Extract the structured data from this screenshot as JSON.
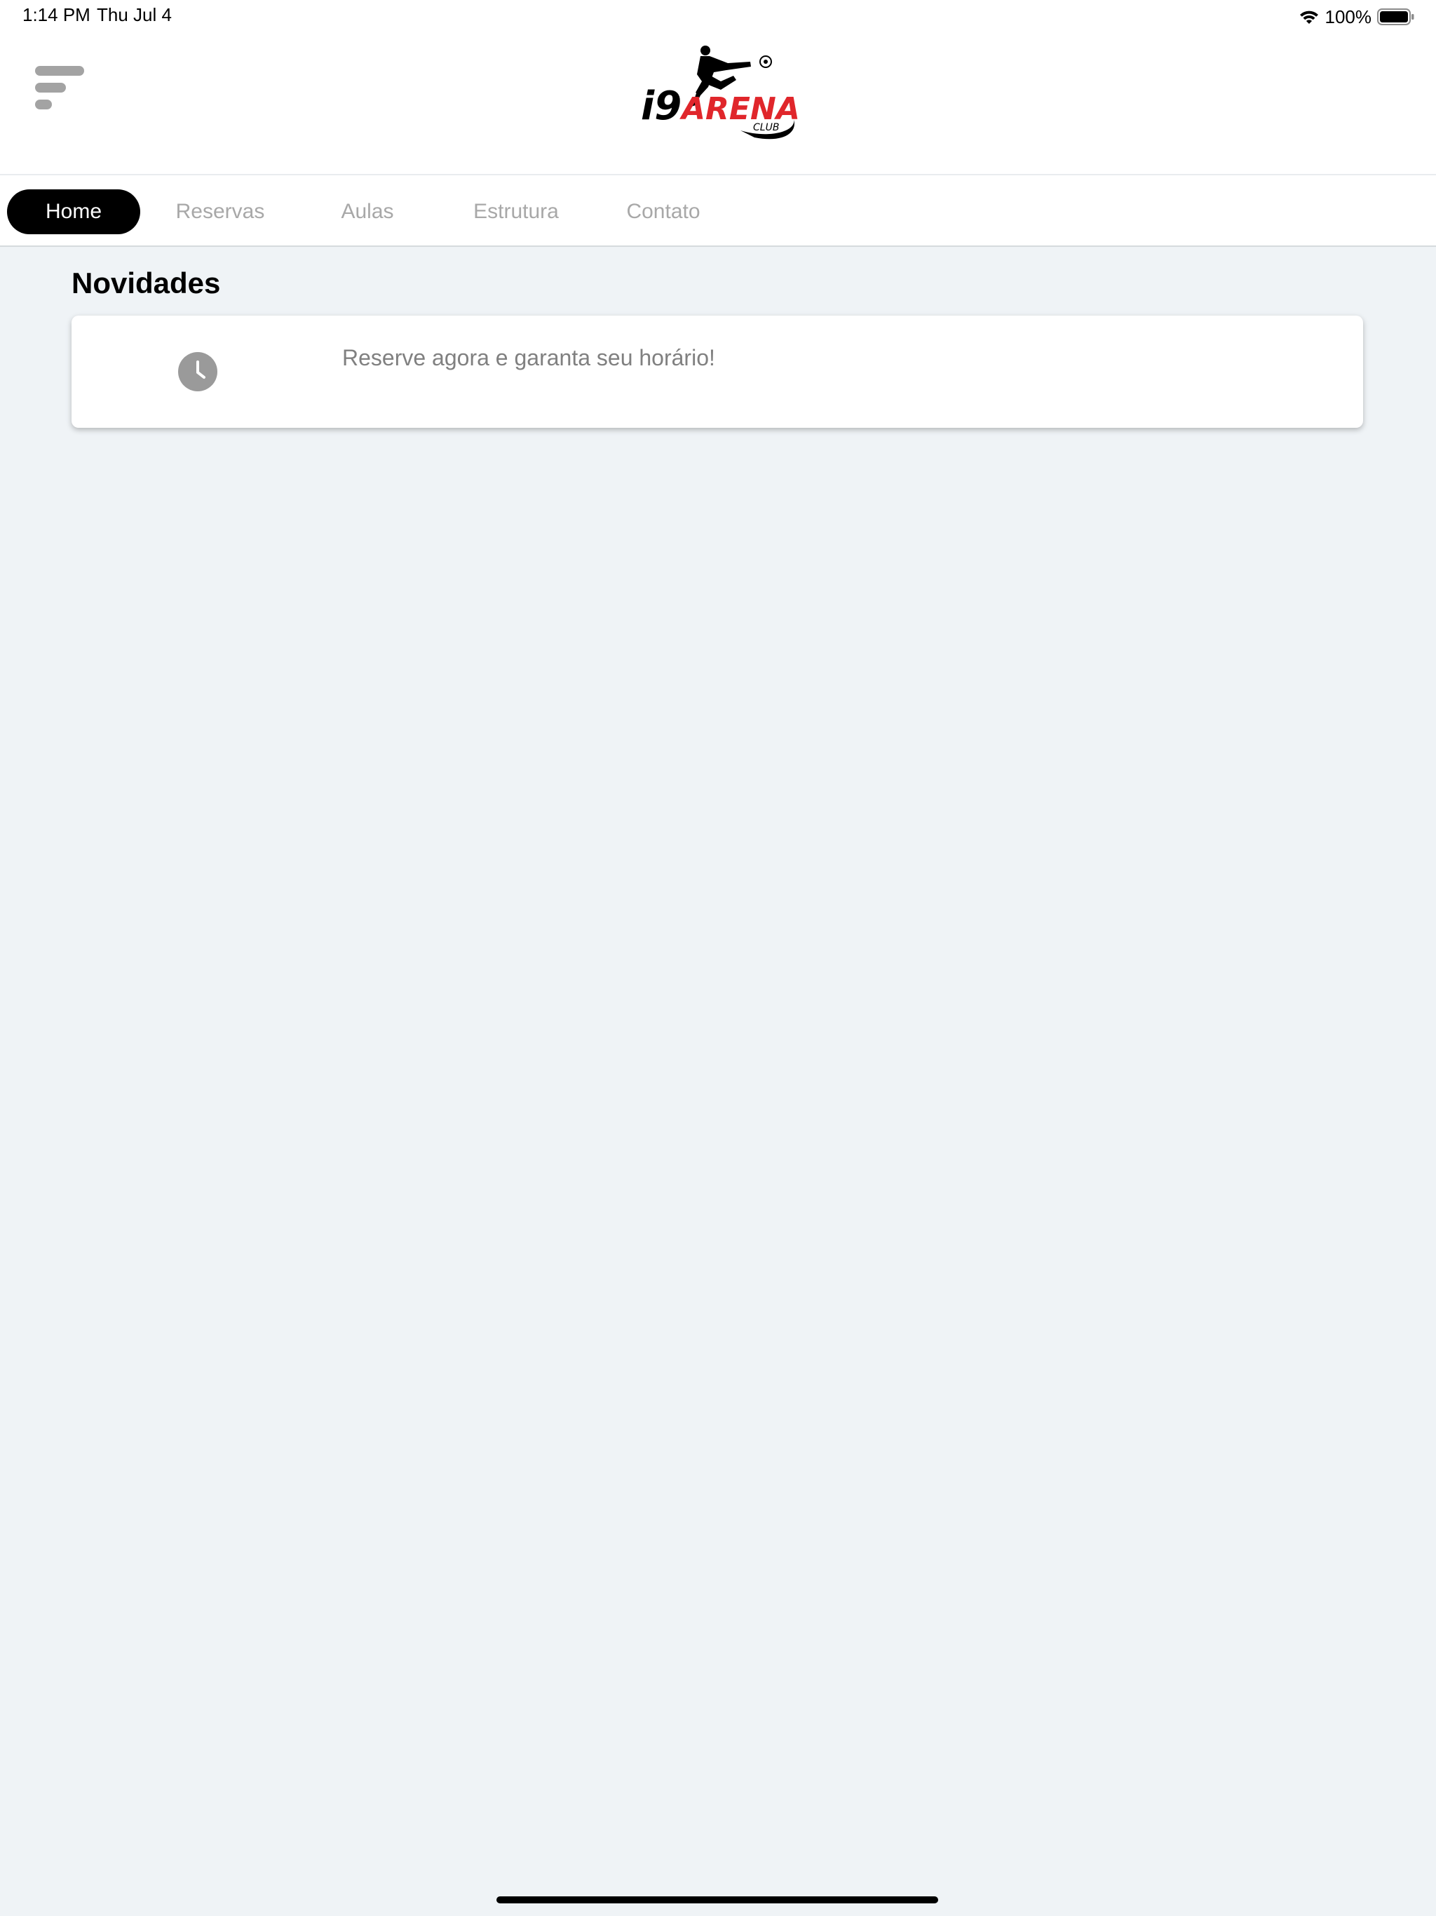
{
  "status_bar": {
    "time": "1:14 PM",
    "date": "Thu Jul 4",
    "battery_percent": "100%",
    "wifi_icon": "wifi-icon",
    "battery_icon": "battery-full-icon"
  },
  "header": {
    "menu_icon": "menu-icon",
    "logo_text": "i9 ARENA",
    "logo_subtext": "CLUB"
  },
  "tabs": [
    {
      "label": "Home",
      "active": true
    },
    {
      "label": "Reservas",
      "active": false
    },
    {
      "label": "Aulas",
      "active": false
    },
    {
      "label": "Estrutura",
      "active": false
    },
    {
      "label": "Contato",
      "active": false
    }
  ],
  "main": {
    "section_title": "Novidades",
    "news": [
      {
        "icon": "clock-icon",
        "text": "Reserve agora e garanta seu horário!"
      }
    ]
  },
  "colors": {
    "background": "#eff3f6",
    "active_tab": "#000000",
    "inactive_tab_text": "#a8a8a8",
    "logo_red": "#e0262b"
  }
}
